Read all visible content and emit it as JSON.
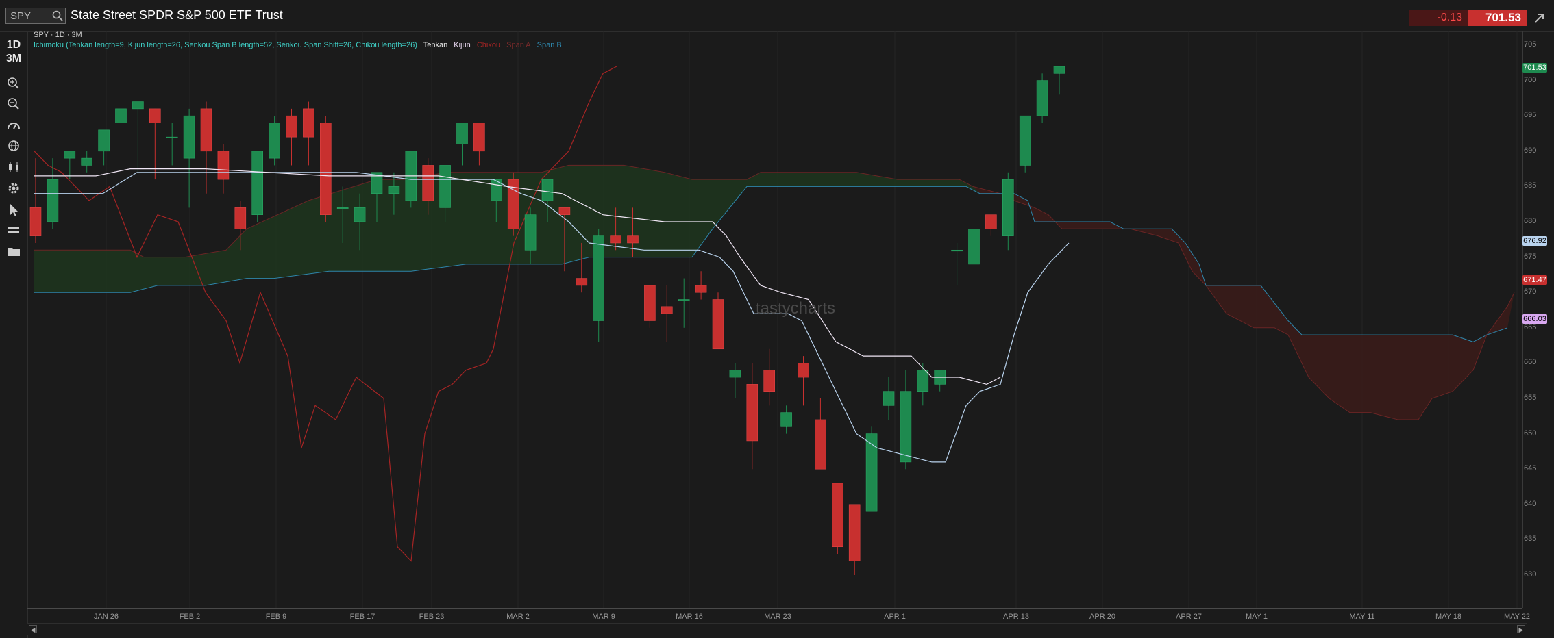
{
  "header": {
    "symbol": "SPY",
    "title": "State Street SPDR S&P 500 ETF Trust",
    "change": "-0.13",
    "price": "701.53"
  },
  "sidebar": {
    "period_1d": "1D",
    "range_3m": "3M"
  },
  "chart": {
    "study_line": "SPY · 1D · 3M",
    "legend": {
      "study": "Ichimoku (Tenkan length=9, Kijun length=26, Senkou Span B length=52, Senkou Span Shift=26, Chikou length=26)",
      "tenkan": "Tenkan",
      "kijun": "Kijun",
      "chikou": "Chikou",
      "span_a": "Span A",
      "span_b": "Span B"
    },
    "watermark": "tastycharts",
    "price_labels": {
      "last": "701.53",
      "span_b_now": "676.92",
      "span_a_now": "671.47",
      "kijun_now": "666.03"
    },
    "colors": {
      "up": "#1e8a4f",
      "down": "#c8302f",
      "tenkan": "#f0e6f5",
      "kijun": "#b9d3ee",
      "chikou": "#a62424",
      "span_a": "#5a2020",
      "span_b": "#2e86ab",
      "cloud_bull": "#1f3a1f",
      "cloud_bear": "#3a1a1a"
    }
  },
  "chart_data": {
    "type": "candlestick",
    "title": "State Street SPDR S&P 500 ETF Trust",
    "y_ticks": [
      630,
      635,
      640,
      645,
      650,
      655,
      660,
      665,
      670,
      675,
      680,
      685,
      690,
      695,
      700,
      705
    ],
    "ylim": [
      626.5,
      707
    ],
    "x_ticks": [
      "JAN 26",
      "FEB 2",
      "FEB 9",
      "FEB 17",
      "FEB 23",
      "MAR 2",
      "MAR 9",
      "MAR 16",
      "MAR 23",
      "APR 1",
      "APR 13",
      "APR 20",
      "APR 27",
      "MAY 1",
      "MAY 11",
      "MAY 18",
      "MAY 22"
    ],
    "candles": [
      {
        "o": 682,
        "h": 689,
        "l": 677,
        "c": 678
      },
      {
        "o": 680,
        "h": 689,
        "l": 679,
        "c": 686
      },
      {
        "o": 689,
        "h": 690,
        "l": 686,
        "c": 690
      },
      {
        "o": 688,
        "h": 690,
        "l": 687,
        "c": 689
      },
      {
        "o": 690,
        "h": 693,
        "l": 688,
        "c": 693
      },
      {
        "o": 694,
        "h": 696,
        "l": 691,
        "c": 696
      },
      {
        "o": 696,
        "h": 697,
        "l": 687,
        "c": 697
      },
      {
        "o": 696,
        "h": 696,
        "l": 686,
        "c": 694
      },
      {
        "o": 692,
        "h": 694,
        "l": 688,
        "c": 692
      },
      {
        "o": 689,
        "h": 696,
        "l": 682,
        "c": 695
      },
      {
        "o": 696,
        "h": 697,
        "l": 684,
        "c": 690
      },
      {
        "o": 690,
        "h": 691,
        "l": 684,
        "c": 686
      },
      {
        "o": 682,
        "h": 683,
        "l": 676,
        "c": 679
      },
      {
        "o": 681,
        "h": 690,
        "l": 680,
        "c": 690
      },
      {
        "o": 689,
        "h": 695,
        "l": 688,
        "c": 694
      },
      {
        "o": 695,
        "h": 696,
        "l": 688,
        "c": 692
      },
      {
        "o": 696,
        "h": 697,
        "l": 688,
        "c": 692
      },
      {
        "o": 694,
        "h": 695,
        "l": 680,
        "c": 681
      },
      {
        "o": 682,
        "h": 685,
        "l": 677,
        "c": 682
      },
      {
        "o": 680,
        "h": 684,
        "l": 676,
        "c": 682
      },
      {
        "o": 684,
        "h": 687,
        "l": 680,
        "c": 687
      },
      {
        "o": 684,
        "h": 687,
        "l": 681,
        "c": 685
      },
      {
        "o": 683,
        "h": 690,
        "l": 682,
        "c": 690
      },
      {
        "o": 688,
        "h": 689,
        "l": 681,
        "c": 683
      },
      {
        "o": 682,
        "h": 688,
        "l": 680,
        "c": 688
      },
      {
        "o": 691,
        "h": 694,
        "l": 688,
        "c": 694
      },
      {
        "o": 694,
        "h": 694,
        "l": 688,
        "c": 690
      },
      {
        "o": 683,
        "h": 686,
        "l": 680,
        "c": 686
      },
      {
        "o": 686,
        "h": 687,
        "l": 678,
        "c": 679
      },
      {
        "o": 676,
        "h": 682,
        "l": 674,
        "c": 681
      },
      {
        "o": 683,
        "h": 686,
        "l": 680,
        "c": 686
      },
      {
        "o": 682,
        "h": 682,
        "l": 673,
        "c": 681
      },
      {
        "o": 672,
        "h": 677,
        "l": 670,
        "c": 671
      },
      {
        "o": 666,
        "h": 679,
        "l": 663,
        "c": 678
      },
      {
        "o": 678,
        "h": 682,
        "l": 676,
        "c": 677
      },
      {
        "o": 678,
        "h": 682,
        "l": 675,
        "c": 677
      },
      {
        "o": 671,
        "h": 671,
        "l": 665,
        "c": 666
      },
      {
        "o": 668,
        "h": 671,
        "l": 663,
        "c": 667
      },
      {
        "o": 669,
        "h": 672,
        "l": 665,
        "c": 669
      },
      {
        "o": 671,
        "h": 673,
        "l": 669,
        "c": 670
      },
      {
        "o": 669,
        "h": 670,
        "l": 662,
        "c": 662
      },
      {
        "o": 658,
        "h": 660,
        "l": 655,
        "c": 659
      },
      {
        "o": 657,
        "h": 660,
        "l": 645,
        "c": 649
      },
      {
        "o": 659,
        "h": 662,
        "l": 654,
        "c": 656
      },
      {
        "o": 651,
        "h": 654,
        "l": 650,
        "c": 653
      },
      {
        "o": 660,
        "h": 661,
        "l": 654,
        "c": 658
      },
      {
        "o": 652,
        "h": 655,
        "l": 645,
        "c": 645
      },
      {
        "o": 643,
        "h": 643,
        "l": 633,
        "c": 634
      },
      {
        "o": 640,
        "h": 640,
        "l": 630,
        "c": 632
      },
      {
        "o": 639,
        "h": 651,
        "l": 639,
        "c": 650
      },
      {
        "o": 654,
        "h": 658,
        "l": 652,
        "c": 656
      },
      {
        "o": 646,
        "h": 659,
        "l": 645,
        "c": 656
      },
      {
        "o": 656,
        "h": 660,
        "l": 654,
        "c": 659
      },
      {
        "o": 657,
        "h": 659,
        "l": 656,
        "c": 659
      },
      {
        "o": 676,
        "h": 677,
        "l": 671,
        "c": 676
      },
      {
        "o": 674,
        "h": 680,
        "l": 673,
        "c": 679
      },
      {
        "o": 681,
        "h": 681,
        "l": 678,
        "c": 679
      },
      {
        "o": 678,
        "h": 687,
        "l": 676,
        "c": 686
      },
      {
        "o": 688,
        "h": 695,
        "l": 687,
        "c": 695
      },
      {
        "o": 695,
        "h": 701,
        "l": 694,
        "c": 700
      },
      {
        "o": 701,
        "h": 702,
        "l": 698,
        "c": 702
      }
    ],
    "tenkan": [
      [
        50,
        686.5
      ],
      [
        140,
        686.5
      ],
      [
        190,
        687.5
      ],
      [
        300,
        687.5
      ],
      [
        480,
        686.5
      ],
      [
        640,
        686.5
      ],
      [
        740,
        685
      ],
      [
        820,
        684
      ],
      [
        880,
        681
      ],
      [
        970,
        680
      ],
      [
        1040,
        680
      ],
      [
        1060,
        678
      ],
      [
        1080,
        675
      ],
      [
        1110,
        671
      ],
      [
        1140,
        670
      ],
      [
        1180,
        669
      ],
      [
        1220,
        663
      ],
      [
        1260,
        661
      ],
      [
        1330,
        661
      ],
      [
        1360,
        658
      ],
      [
        1400,
        658
      ],
      [
        1440,
        657
      ],
      [
        1460,
        658
      ]
    ],
    "kijun": [
      [
        50,
        684
      ],
      [
        150,
        684
      ],
      [
        200,
        687
      ],
      [
        340,
        687
      ],
      [
        520,
        687
      ],
      [
        600,
        686
      ],
      [
        720,
        686
      ],
      [
        760,
        684
      ],
      [
        790,
        683
      ],
      [
        830,
        680
      ],
      [
        860,
        677
      ],
      [
        940,
        676
      ],
      [
        1020,
        676
      ],
      [
        1050,
        675
      ],
      [
        1070,
        673
      ],
      [
        1100,
        667
      ],
      [
        1150,
        667
      ],
      [
        1170,
        666
      ],
      [
        1250,
        650
      ],
      [
        1280,
        648
      ],
      [
        1320,
        647
      ],
      [
        1360,
        646
      ],
      [
        1380,
        646
      ],
      [
        1410,
        654
      ],
      [
        1430,
        656
      ],
      [
        1460,
        657
      ],
      [
        1480,
        664
      ],
      [
        1500,
        670
      ],
      [
        1530,
        674
      ],
      [
        1560,
        677
      ]
    ],
    "chikou": [
      [
        50,
        690
      ],
      [
        70,
        688
      ],
      [
        90,
        687
      ],
      [
        130,
        683
      ],
      [
        160,
        685
      ],
      [
        200,
        675
      ],
      [
        230,
        681
      ],
      [
        260,
        680
      ],
      [
        300,
        670
      ],
      [
        330,
        666
      ],
      [
        350,
        660
      ],
      [
        380,
        670
      ],
      [
        420,
        661
      ],
      [
        440,
        648
      ],
      [
        460,
        654
      ],
      [
        490,
        652
      ],
      [
        520,
        658
      ],
      [
        560,
        655
      ],
      [
        580,
        634
      ],
      [
        600,
        632
      ],
      [
        620,
        650
      ],
      [
        640,
        656
      ],
      [
        660,
        657
      ],
      [
        680,
        659
      ],
      [
        710,
        660
      ],
      [
        720,
        662
      ],
      [
        750,
        677
      ],
      [
        790,
        686
      ],
      [
        830,
        690
      ],
      [
        860,
        697
      ],
      [
        880,
        701
      ],
      [
        900,
        702
      ]
    ],
    "span_a": [
      [
        50,
        676
      ],
      [
        190,
        676
      ],
      [
        210,
        675
      ],
      [
        270,
        675
      ],
      [
        330,
        676
      ],
      [
        360,
        679
      ],
      [
        450,
        683
      ],
      [
        550,
        686
      ],
      [
        600,
        686
      ],
      [
        650,
        687
      ],
      [
        750,
        687
      ],
      [
        790,
        687
      ],
      [
        830,
        688
      ],
      [
        870,
        688
      ],
      [
        910,
        688
      ],
      [
        970,
        687
      ],
      [
        1010,
        686
      ],
      [
        1050,
        686
      ],
      [
        1090,
        686
      ],
      [
        1110,
        687
      ],
      [
        1150,
        687
      ],
      [
        1250,
        687
      ],
      [
        1310,
        686
      ],
      [
        1340,
        686
      ],
      [
        1400,
        686
      ],
      [
        1420,
        685
      ],
      [
        1460,
        684
      ],
      [
        1480,
        683
      ],
      [
        1510,
        682
      ],
      [
        1530,
        681
      ],
      [
        1550,
        679
      ],
      [
        1570,
        679
      ],
      [
        1610,
        679
      ],
      [
        1650,
        679
      ],
      [
        1690,
        678
      ],
      [
        1720,
        677
      ],
      [
        1740,
        673
      ],
      [
        1760,
        671
      ],
      [
        1790,
        667
      ],
      [
        1830,
        665
      ],
      [
        1860,
        665
      ],
      [
        1880,
        664
      ],
      [
        1910,
        658
      ],
      [
        1940,
        655
      ],
      [
        1970,
        653
      ],
      [
        2000,
        653
      ],
      [
        2040,
        652
      ],
      [
        2070,
        652
      ],
      [
        2090,
        655
      ],
      [
        2120,
        656
      ],
      [
        2150,
        659
      ],
      [
        2170,
        664
      ],
      [
        2200,
        668
      ],
      [
        2210,
        670
      ]
    ],
    "span_b": [
      [
        50,
        670
      ],
      [
        190,
        670
      ],
      [
        230,
        671
      ],
      [
        300,
        671
      ],
      [
        360,
        672
      ],
      [
        400,
        672
      ],
      [
        480,
        673
      ],
      [
        600,
        673
      ],
      [
        680,
        674
      ],
      [
        760,
        674
      ],
      [
        820,
        674
      ],
      [
        860,
        675
      ],
      [
        880,
        675
      ],
      [
        1010,
        675
      ],
      [
        1040,
        679
      ],
      [
        1090,
        685
      ],
      [
        1110,
        685
      ],
      [
        1410,
        685
      ],
      [
        1430,
        684
      ],
      [
        1460,
        684
      ],
      [
        1480,
        684
      ],
      [
        1500,
        683
      ],
      [
        1510,
        680
      ],
      [
        1560,
        680
      ],
      [
        1620,
        680
      ],
      [
        1640,
        679
      ],
      [
        1710,
        679
      ],
      [
        1730,
        677
      ],
      [
        1750,
        674
      ],
      [
        1760,
        671
      ],
      [
        1840,
        671
      ],
      [
        1880,
        666
      ],
      [
        1900,
        664
      ],
      [
        2000,
        664
      ],
      [
        2030,
        664
      ],
      [
        2120,
        664
      ],
      [
        2150,
        663
      ],
      [
        2170,
        664
      ],
      [
        2200,
        665
      ]
    ]
  }
}
